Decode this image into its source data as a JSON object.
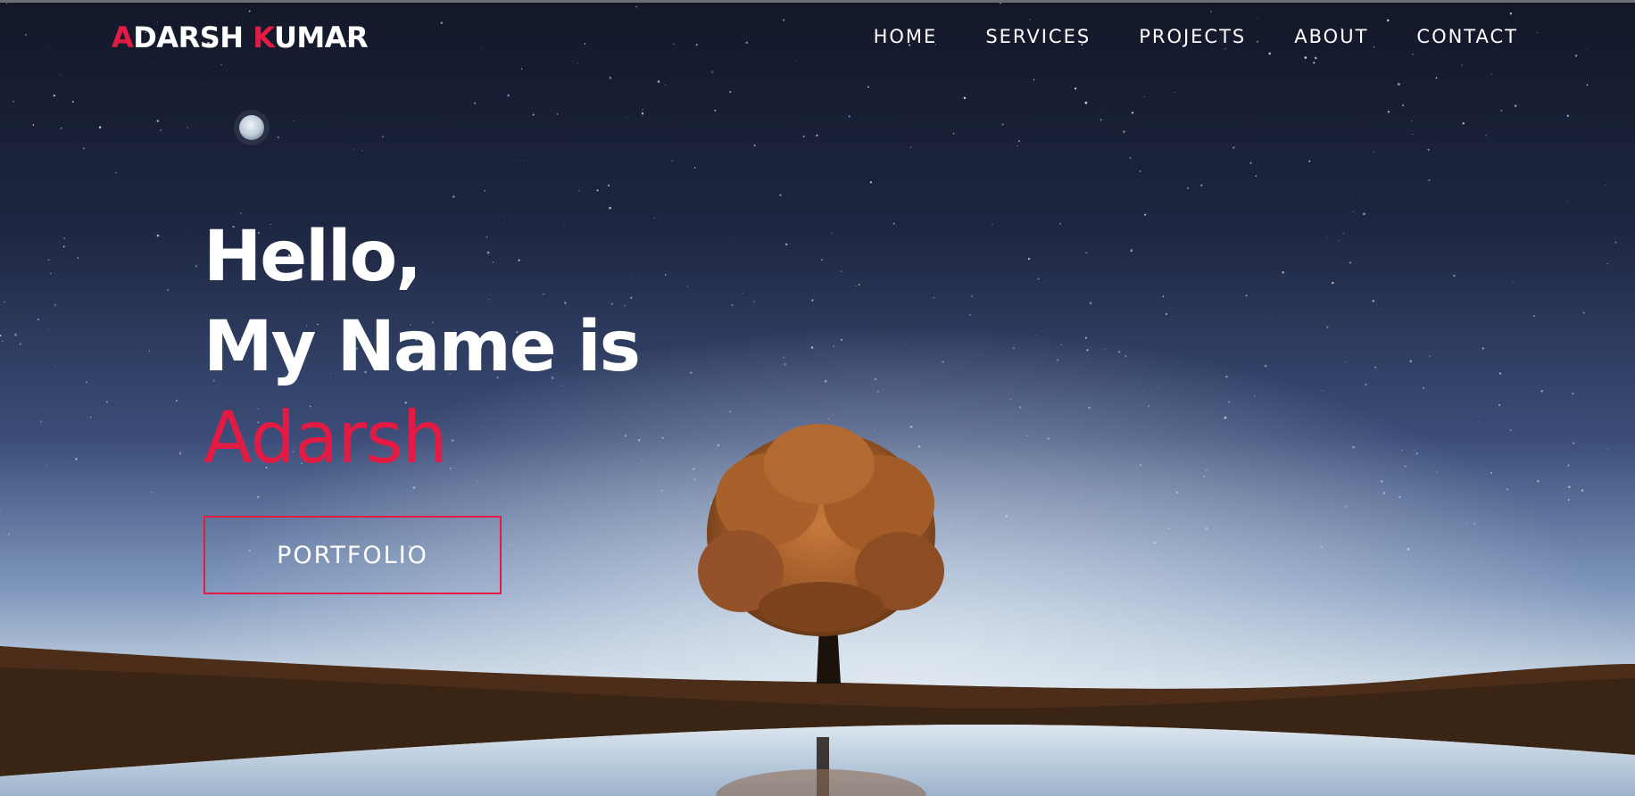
{
  "navbar": {
    "logo": {
      "first_initial": "A",
      "first_rest": "DARSH ",
      "last_initial": "K",
      "last_rest": "UMAR"
    },
    "links": [
      {
        "label": "HOME"
      },
      {
        "label": "SERVICES"
      },
      {
        "label": "PROJECTS"
      },
      {
        "label": "ABOUT"
      },
      {
        "label": "CONTACT"
      }
    ]
  },
  "hero": {
    "greeting": "Hello,",
    "intro": "My Name is",
    "name": "Adarsh",
    "button_label": "PORTFOLIO"
  },
  "colors": {
    "accent": "#e21b45",
    "text": "#ffffff",
    "sky_top": "#141a2c",
    "sky_horizon": "#b9c9db",
    "ground": "#3a2414",
    "tree_foliage": "#a8602a"
  },
  "icons": {
    "background": "night-sky-lake-tree-image",
    "moon": "moon-icon"
  }
}
